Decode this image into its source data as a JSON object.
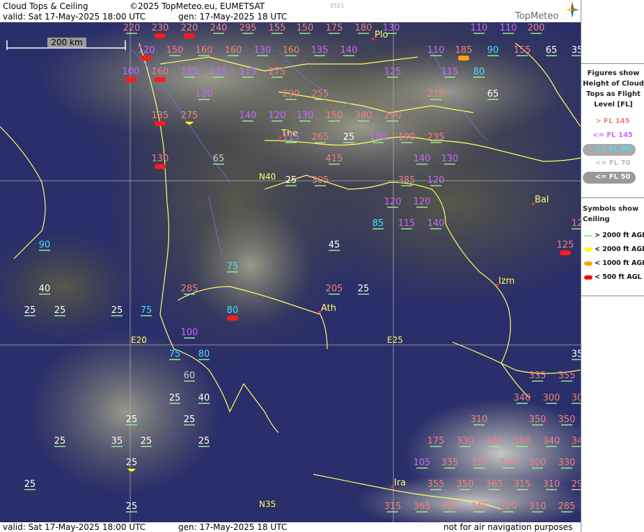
{
  "header": {
    "title": "Cloud Tops & Ceiling",
    "copyright": "©2025 TopMeteo.eu, EUMETSAT",
    "code": "9521",
    "valid": "valid:  Sat  17-May-2025  18:00 UTC",
    "gen": "gen: 17-May-2025 18 UTC",
    "logo": "TopMeteo"
  },
  "footer": {
    "valid": "valid:  Sat  17-May-2025  18:00 UTC",
    "gen": "gen: 17-May-2025 18 UTC",
    "note": "not for air navigation purposes"
  },
  "scale": "200 km",
  "colors": {
    "high": "#f08080",
    "mid": "#cc66ff",
    "low90": "#40e0ff",
    "low70": "#cccccc",
    "low50": "#ffffff",
    "city": "#ffff66",
    "ocean": "#2a2e6a"
  },
  "legend": {
    "title": [
      "Figures show",
      "Height of Cloud",
      "Tops as Flight",
      "Level  [FL]"
    ],
    "items": [
      "> FL 145",
      "<= FL 145",
      "<= FL 90",
      "<= FL 70",
      "<= FL 50"
    ],
    "symbols_title": [
      "Symbols show",
      "Ceiling"
    ],
    "symbols": [
      "> 2000 ft AGL",
      "< 2000 ft AGL",
      "< 1000 ft AGL",
      "< 500 ft AGL"
    ]
  },
  "grid_labels": [
    "N40",
    "N35",
    "E20",
    "E25"
  ],
  "cities": [
    "Plo",
    "The",
    "Bal",
    "Izm",
    "Ath",
    "Ira"
  ],
  "labels": [
    {
      "v": "220",
      "c": "high"
    },
    {
      "v": "230",
      "c": "high",
      "s": "red"
    },
    {
      "v": "220",
      "c": "high",
      "s": "red"
    },
    {
      "v": "240",
      "c": "high"
    },
    {
      "v": "295",
      "c": "high"
    },
    {
      "v": "155",
      "c": "high"
    },
    {
      "v": "150",
      "c": "high"
    },
    {
      "v": "175",
      "c": "high"
    },
    {
      "v": "180",
      "c": "high"
    },
    {
      "v": "130",
      "c": "mid"
    },
    {
      "v": "110",
      "c": "mid"
    },
    {
      "v": "110",
      "c": "mid"
    },
    {
      "v": "200",
      "c": "high"
    },
    {
      "v": "120",
      "c": "mid",
      "s": "red"
    },
    {
      "v": "150",
      "c": "high"
    },
    {
      "v": "160",
      "c": "high"
    },
    {
      "v": "160",
      "c": "high"
    },
    {
      "v": "130",
      "c": "mid"
    },
    {
      "v": "160",
      "c": "high"
    },
    {
      "v": "135",
      "c": "mid"
    },
    {
      "v": "140",
      "c": "mid"
    },
    {
      "v": "110",
      "c": "mid"
    },
    {
      "v": "185",
      "c": "high",
      "s": "orange"
    },
    {
      "v": "90",
      "c": "low90"
    },
    {
      "v": "155",
      "c": "high"
    },
    {
      "v": "65",
      "c": "low50"
    },
    {
      "v": "35",
      "c": "low50"
    },
    {
      "v": "100",
      "c": "mid",
      "s": "red"
    },
    {
      "v": "160",
      "c": "high",
      "s": "red"
    },
    {
      "v": "125",
      "c": "mid"
    },
    {
      "v": "135",
      "c": "mid"
    },
    {
      "v": "115",
      "c": "mid"
    },
    {
      "v": "275",
      "c": "high"
    },
    {
      "v": "125",
      "c": "mid"
    },
    {
      "v": "115",
      "c": "mid"
    },
    {
      "v": "80",
      "c": "low90"
    },
    {
      "v": "120",
      "c": "mid"
    },
    {
      "v": "290",
      "c": "high"
    },
    {
      "v": "255",
      "c": "high"
    },
    {
      "v": "215",
      "c": "high"
    },
    {
      "v": "65",
      "c": "low50"
    },
    {
      "v": "135",
      "c": "high",
      "s": "red"
    },
    {
      "v": "275",
      "c": "high",
      "s": "yellow"
    },
    {
      "v": "140",
      "c": "mid"
    },
    {
      "v": "120",
      "c": "mid"
    },
    {
      "v": "130",
      "c": "mid"
    },
    {
      "v": "150",
      "c": "high"
    },
    {
      "v": "380",
      "c": "high"
    },
    {
      "v": "290",
      "c": "high"
    },
    {
      "v": "115",
      "c": "mid"
    },
    {
      "v": "265",
      "c": "high"
    },
    {
      "v": "25",
      "c": "low50"
    },
    {
      "v": "100",
      "c": "mid"
    },
    {
      "v": "190",
      "c": "high"
    },
    {
      "v": "235",
      "c": "high"
    },
    {
      "v": "130",
      "c": "high",
      "s": "red"
    },
    {
      "v": "65",
      "c": "low70"
    },
    {
      "v": "415",
      "c": "high"
    },
    {
      "v": "140",
      "c": "mid"
    },
    {
      "v": "130",
      "c": "mid"
    },
    {
      "v": "25",
      "c": "low50"
    },
    {
      "v": "305",
      "c": "high"
    },
    {
      "v": "385",
      "c": "high"
    },
    {
      "v": "120",
      "c": "mid"
    },
    {
      "v": "120",
      "c": "mid"
    },
    {
      "v": "120",
      "c": "mid"
    },
    {
      "v": "85",
      "c": "low90"
    },
    {
      "v": "115",
      "c": "mid"
    },
    {
      "v": "140",
      "c": "mid"
    },
    {
      "v": "12",
      "c": "high"
    },
    {
      "v": "90",
      "c": "low90"
    },
    {
      "v": "45",
      "c": "low50"
    },
    {
      "v": "125",
      "c": "high",
      "s": "red"
    },
    {
      "v": "75",
      "c": "low90"
    },
    {
      "v": "40",
      "c": "low50"
    },
    {
      "v": "285",
      "c": "high"
    },
    {
      "v": "205",
      "c": "high"
    },
    {
      "v": "25",
      "c": "low50"
    },
    {
      "v": "25",
      "c": "low50"
    },
    {
      "v": "25",
      "c": "low50"
    },
    {
      "v": "25",
      "c": "low50"
    },
    {
      "v": "75",
      "c": "low90"
    },
    {
      "v": "80",
      "c": "low90",
      "s": "red"
    },
    {
      "v": "100",
      "c": "mid"
    },
    {
      "v": "75",
      "c": "low90"
    },
    {
      "v": "80",
      "c": "low90"
    },
    {
      "v": "35",
      "c": "low50"
    },
    {
      "v": "60",
      "c": "low70"
    },
    {
      "v": "335",
      "c": "high"
    },
    {
      "v": "355",
      "c": "high"
    },
    {
      "v": "25",
      "c": "low50"
    },
    {
      "v": "40",
      "c": "low50"
    },
    {
      "v": "340",
      "c": "high"
    },
    {
      "v": "300",
      "c": "high"
    },
    {
      "v": "30",
      "c": "high"
    },
    {
      "v": "25",
      "c": "low50"
    },
    {
      "v": "25",
      "c": "low50"
    },
    {
      "v": "310",
      "c": "high"
    },
    {
      "v": "350",
      "c": "high"
    },
    {
      "v": "350",
      "c": "high"
    },
    {
      "v": "25",
      "c": "low50"
    },
    {
      "v": "35",
      "c": "low50"
    },
    {
      "v": "25",
      "c": "low50"
    },
    {
      "v": "25",
      "c": "low50"
    },
    {
      "v": "175",
      "c": "high"
    },
    {
      "v": "330",
      "c": "high"
    },
    {
      "v": "335",
      "c": "high"
    },
    {
      "v": "360",
      "c": "high"
    },
    {
      "v": "340",
      "c": "high"
    },
    {
      "v": "34",
      "c": "high"
    },
    {
      "v": "25",
      "c": "low50",
      "s": "yellow"
    },
    {
      "v": "105",
      "c": "mid"
    },
    {
      "v": "335",
      "c": "high"
    },
    {
      "v": "350",
      "c": "high"
    },
    {
      "v": "340",
      "c": "high"
    },
    {
      "v": "300",
      "c": "high"
    },
    {
      "v": "330",
      "c": "high"
    },
    {
      "v": "25",
      "c": "low50"
    },
    {
      "v": "355",
      "c": "high"
    },
    {
      "v": "350",
      "c": "high"
    },
    {
      "v": "365",
      "c": "high"
    },
    {
      "v": "315",
      "c": "high"
    },
    {
      "v": "310",
      "c": "high"
    },
    {
      "v": "29",
      "c": "high"
    },
    {
      "v": "25",
      "c": "low50"
    },
    {
      "v": "315",
      "c": "high"
    },
    {
      "v": "365",
      "c": "high"
    },
    {
      "v": "360",
      "c": "high"
    },
    {
      "v": "345",
      "c": "high"
    },
    {
      "v": "320",
      "c": "high"
    },
    {
      "v": "310",
      "c": "high"
    },
    {
      "v": "285",
      "c": "high"
    }
  ]
}
